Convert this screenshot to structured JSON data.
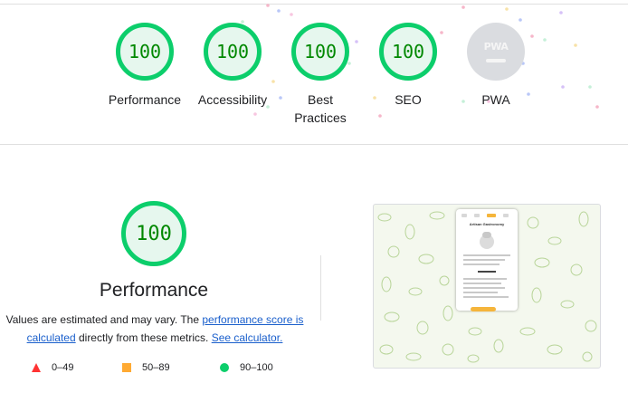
{
  "summary": {
    "gauges": [
      {
        "score": "100",
        "label": "Performance"
      },
      {
        "score": "100",
        "label": "Accessibility"
      },
      {
        "score": "100",
        "label": "Best Practices"
      },
      {
        "score": "100",
        "label": "SEO"
      }
    ],
    "pwa": {
      "badge": "PWA",
      "label": "PWA"
    }
  },
  "performance": {
    "score": "100",
    "title": "Performance",
    "description": {
      "prefix": "Values are estimated and may vary. The ",
      "link1": "performance score is calculated",
      "middle": " directly from these metrics. ",
      "link2": "See calculator."
    },
    "legend": [
      {
        "range": "0–49",
        "icon": "fail-triangle-icon",
        "color": "#ff3333"
      },
      {
        "range": "50–89",
        "icon": "average-square-icon",
        "color": "#ffaa33"
      },
      {
        "range": "90–100",
        "icon": "pass-circle-icon",
        "color": "#0cce6b"
      }
    ]
  },
  "screenshot": {
    "page_title": "Artisan Gastronomy"
  },
  "colors": {
    "pass": "#0cce6b",
    "pass_text": "#008800",
    "link": "#1a5fcc"
  }
}
